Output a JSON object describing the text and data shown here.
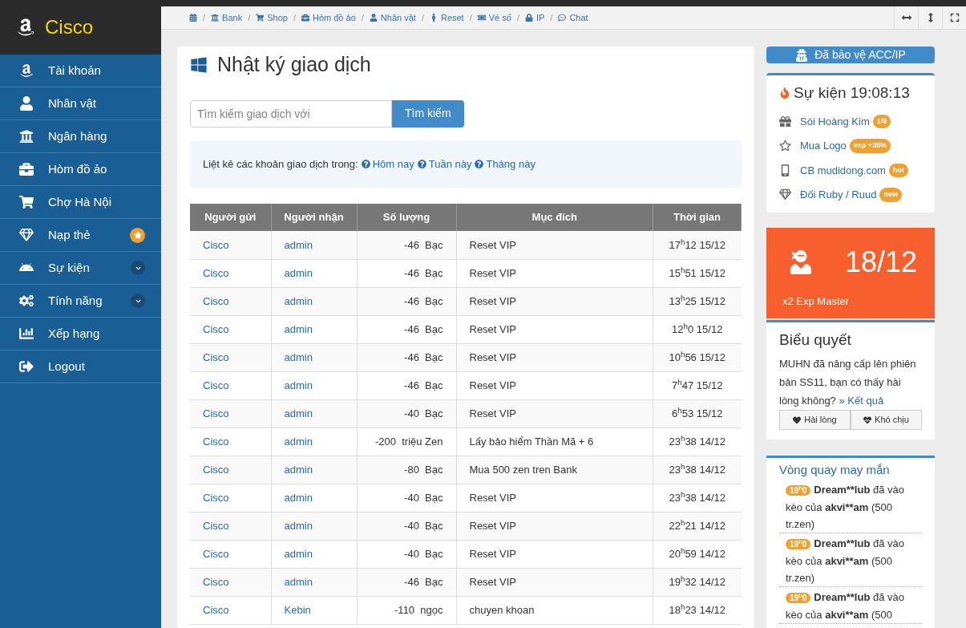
{
  "sidebar": {
    "logo": "Cisco",
    "items": [
      {
        "label": "Tài khoản"
      },
      {
        "label": "Nhân vật"
      },
      {
        "label": "Ngân hàng"
      },
      {
        "label": "Hòm đồ ảo"
      },
      {
        "label": "Chợ Hà Nội"
      },
      {
        "label": "Nạp thẻ",
        "kind": "star"
      },
      {
        "label": "Sự kiện",
        "kind": "expand",
        "expanded": false
      },
      {
        "label": "Tính năng",
        "kind": "expand",
        "expanded": false
      },
      {
        "label": "Xếp hạng"
      },
      {
        "label": "Logout"
      }
    ]
  },
  "breadcrumbs": [
    {
      "separator": "/"
    },
    {
      "label": "Bank",
      "separator": "/"
    },
    {
      "label": "Shop",
      "separator": "/"
    },
    {
      "label": "Hòm đồ ảo",
      "separator": "/"
    },
    {
      "label": "Nhân vật",
      "separator": "/"
    },
    {
      "label": "Reset",
      "separator": "/"
    },
    {
      "label": "Vé số",
      "separator": "/"
    },
    {
      "label": "IP",
      "separator": "/"
    },
    {
      "label": "Chat"
    }
  ],
  "main": {
    "title": "Nhật ký giao dịch",
    "search": {
      "placeholder": "Tìm kiếm giao dịch với",
      "button": "Tìm kiếm"
    },
    "filter": {
      "text": "Liệt kê các khoản giao dịch trong:",
      "links": [
        "Hôm nay",
        "Tuần này",
        "Tháng này"
      ]
    },
    "table": {
      "columns": [
        "Người gửi",
        "Người nhận",
        "Số lượng",
        "Mục đích",
        "Thời gian"
      ],
      "rows": [
        [
          "Cisco",
          "admin",
          "-46  Bạc",
          "Reset VIP",
          "17$^{h}$12 15/12"
        ],
        [
          "Cisco",
          "admin",
          "-46  Bạc",
          "Reset VIP",
          "15$^{h}$51 15/12"
        ],
        [
          "Cisco",
          "admin",
          "-46  Bạc",
          "Reset VIP",
          "13$^{h}$25 15/12"
        ],
        [
          "Cisco",
          "admin",
          "-46  Bạc",
          "Reset VIP",
          "12$^{h}$0 15/12"
        ],
        [
          "Cisco",
          "admin",
          "-46  Bạc",
          "Reset VIP",
          "10$^{h}$56 15/12"
        ],
        [
          "Cisco",
          "admin",
          "-46  Bạc",
          "Reset VIP",
          "7$^{h}$47 15/12"
        ],
        [
          "Cisco",
          "admin",
          "-40  Bạc",
          "Reset VIP",
          "6$^{h}$53 15/12"
        ],
        [
          "Cisco",
          "admin",
          "-200  triệu Zen",
          "Lấy bảo hiểm Thần Mã + 6",
          "23$^{h}$38 14/12"
        ],
        [
          "Cisco",
          "admin",
          "-80  Bạc",
          "Mua 500 zen tren Bank",
          "23$^{h}$38 14/12"
        ],
        [
          "Cisco",
          "admin",
          "-40  Bạc",
          "Reset VIP",
          "23$^{h}$38 14/12"
        ],
        [
          "Cisco",
          "admin",
          "-40  Bạc",
          "Reset VIP",
          "22$^{h}$21 14/12"
        ],
        [
          "Cisco",
          "admin",
          "-40  Bạc",
          "Reset VIP",
          "20$^{h}$59 14/12"
        ],
        [
          "Cisco",
          "admin",
          "-46  Bạc",
          "Reset VIP",
          "19$^{h}$32 14/12"
        ],
        [
          "Cisco",
          "Kebin",
          "-110  ngọc",
          "chuyen khoan",
          "18$^{h}$23 14/12"
        ]
      ]
    }
  },
  "right": {
    "protect_button": "Đã bảo vệ ACC/IP",
    "event": {
      "title": "Sự kiện 19:08:13",
      "items": [
        {
          "label": "Sói Hoàng Kim",
          "badge": "1/9"
        },
        {
          "label": "Mua Logo",
          "badge": "exp +35%"
        },
        {
          "label": "CB mudidong.com",
          "badge": "hot"
        },
        {
          "label": "Đối Ruby / Ruud",
          "badge": "new"
        }
      ]
    },
    "promo": {
      "date": "18/12",
      "caption": "x2 Exp Master"
    },
    "poll": {
      "title": "Biểu quyết",
      "question": "MUHN đã nâng cấp lên phiên bản SS11, bạn có thấy hài lòng không?",
      "result_link": "» Kết quả",
      "options": [
        "Hài lòng",
        "Khó chịu"
      ]
    },
    "wheel": {
      "title": "Vòng quay may mắn",
      "items": [
        {
          "time": "19$^{h}$0",
          "user": "Dream**lub",
          "action": "đã vào kèo của",
          "target": "akvi**am",
          "amount": "(500 tr.zen)"
        },
        {
          "time": "19$^{h}$0",
          "user": "Dream**lub",
          "action": "đã vào kèo của",
          "target": "akvi**am",
          "amount": "(500 tr.zen)"
        },
        {
          "time": "19$^{h}$0",
          "user": "Dream**lub",
          "action": "đã vào kèo của",
          "target": "akvi**am",
          "amount": "(500"
        }
      ]
    }
  }
}
